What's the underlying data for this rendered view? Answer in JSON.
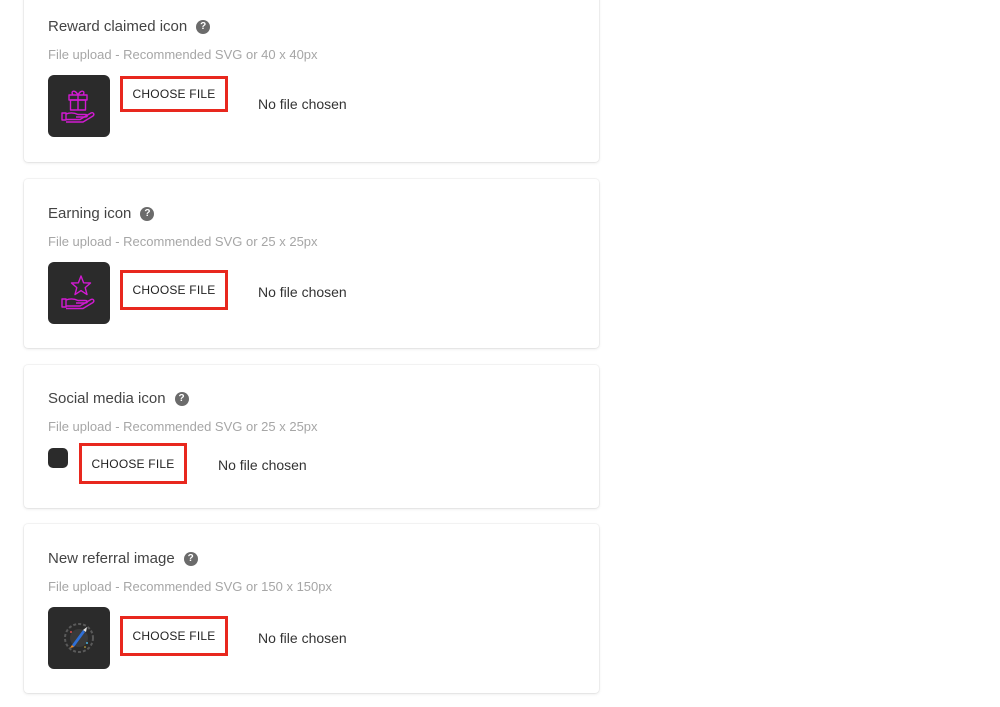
{
  "help_glyph": "?",
  "accent_color": "#e8281e",
  "icon_color": "#d21ad2",
  "cards": [
    {
      "title": "Reward claimed icon",
      "subtitle": "File upload - Recommended SVG or 40 x 40px",
      "preview_icon": "gift-in-hand-icon",
      "button_label": "CHOOSE FILE",
      "status": "No file chosen"
    },
    {
      "title": "Earning icon",
      "subtitle": "File upload - Recommended SVG or 25 x 25px",
      "preview_icon": "star-in-hand-icon",
      "button_label": "CHOOSE FILE",
      "status": "No file chosen"
    },
    {
      "title": "Social media icon",
      "subtitle": "File upload - Recommended SVG or 25 x 25px",
      "preview_icon": "empty-preview",
      "button_label": "CHOOSE FILE",
      "status": "No file chosen"
    },
    {
      "title": "New referral image",
      "subtitle": "File upload - Recommended SVG or 150 x 150px",
      "preview_icon": "rocket-badge-icon",
      "button_label": "CHOOSE FILE",
      "status": "No file chosen"
    }
  ]
}
